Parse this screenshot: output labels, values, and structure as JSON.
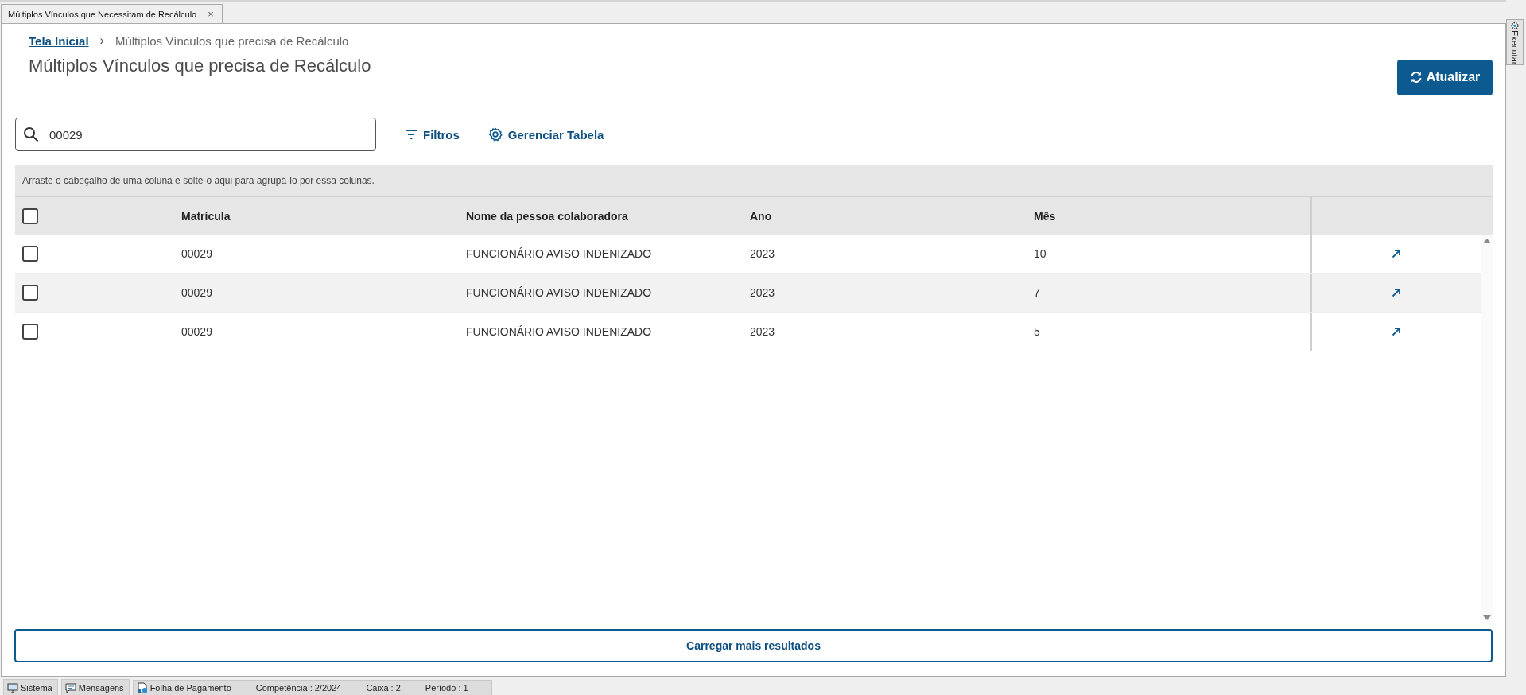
{
  "tab": {
    "label": "Múltiplos Vínculos que Necessitam de Recálculo",
    "close": "×"
  },
  "side_tab": {
    "label": "Executar"
  },
  "breadcrumb": {
    "home": "Tela Inicial",
    "separator": "›",
    "current": "Múltiplos Vínculos que precisa de Recálculo"
  },
  "title": "Múltiplos Vínculos que precisa de Recálculo",
  "refresh_button": "Atualizar",
  "search": {
    "value": "00029"
  },
  "toolbar": [
    {
      "kind": "filter",
      "label": "Filtros"
    },
    {
      "kind": "settings",
      "label": "Gerenciar Tabela"
    }
  ],
  "group_hint": "Arraste o cabeçalho de uma coluna e solte-o aqui para agrupá-lo por essa colunas.",
  "table": {
    "all_checked": false,
    "columns": [
      "Matrícula",
      "Nome da pessoa colaboradora",
      "Ano",
      "Mês"
    ],
    "rows": [
      {
        "checked": false,
        "cells": [
          "00029",
          "FUNCIONÁRIO AVISO INDENIZADO",
          "2023",
          "10"
        ]
      },
      {
        "checked": false,
        "cells": [
          "00029",
          "FUNCIONÁRIO AVISO INDENIZADO",
          "2023",
          "7"
        ]
      },
      {
        "checked": false,
        "cells": [
          "00029",
          "FUNCIONÁRIO AVISO INDENIZADO",
          "2023",
          "5"
        ]
      }
    ]
  },
  "load_more": "Carregar mais resultados",
  "status_bar": {
    "items": [
      {
        "kind": "system",
        "label": "Sistema"
      },
      {
        "kind": "messages",
        "label": "Mensagens"
      },
      {
        "kind": "payroll",
        "label": "Folha de Pagamento"
      }
    ],
    "fields": [
      "Competência : 2/2024",
      "Caixa : 2",
      "Período : 1"
    ]
  }
}
